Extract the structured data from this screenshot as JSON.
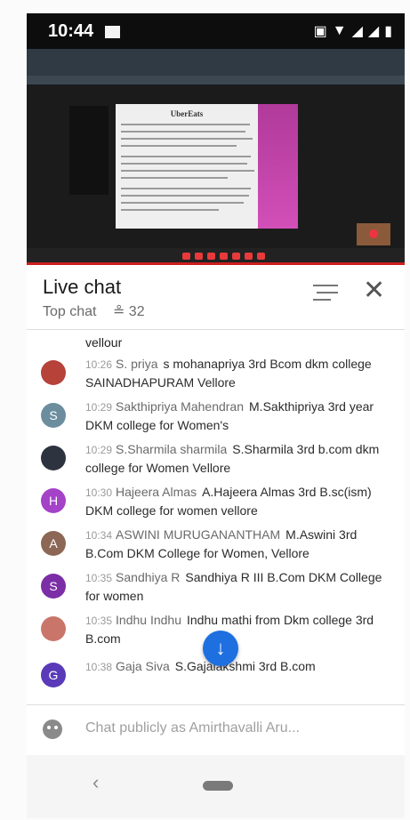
{
  "status_bar": {
    "time": "10:44"
  },
  "video": {
    "slide_title": "UberEats"
  },
  "chat_header": {
    "title": "Live chat",
    "mode": "Top chat",
    "viewer_count": "32"
  },
  "chat": {
    "top_fragment": "vellour",
    "messages": [
      {
        "time": "10:26",
        "author": "S. priya",
        "text": "s mohanapriya 3rd Bcom dkm college SAINADHAPURAM Vellore",
        "avatar_letter": "",
        "avatar_color": "#b6423a"
      },
      {
        "time": "10:29",
        "author": "Sakthipriya Mahendran",
        "text": "M.Sakthipriya 3rd year DKM college for Women's",
        "avatar_letter": "S",
        "avatar_color": "#6b8d9e"
      },
      {
        "time": "10:29",
        "author": "S.Sharmila sharmila",
        "text": "S.Sharmila 3rd b.com dkm college for Women Vellore",
        "avatar_letter": "",
        "avatar_color": "#2e3340"
      },
      {
        "time": "10:30",
        "author": "Hajeera Almas",
        "text": "A.Hajeera Almas 3rd B.sc(ism) DKM college for women vellore",
        "avatar_letter": "H",
        "avatar_color": "#a442c8"
      },
      {
        "time": "10:34",
        "author": "ASWINI MURUGANANTHAM",
        "text": "M.Aswini 3rd B.Com DKM College for Women, Vellore",
        "avatar_letter": "A",
        "avatar_color": "#8c6756"
      },
      {
        "time": "10:35",
        "author": "Sandhiya R",
        "text": "Sandhiya R III B.Com DKM College for women",
        "avatar_letter": "S",
        "avatar_color": "#7b2ea6"
      },
      {
        "time": "10:35",
        "author": "Indhu Indhu",
        "text": "Indhu mathi from Dkm college 3rd B.com",
        "avatar_letter": "",
        "avatar_color": "#c9756a"
      },
      {
        "time": "10:38",
        "author": "Gaja Siva",
        "text": "S.Gajalakshmi 3rd B.com",
        "avatar_letter": "G",
        "avatar_color": "#5a3ab8"
      }
    ]
  },
  "input": {
    "placeholder": "Chat publicly as Amirthavalli Aru..."
  },
  "nav": {
    "back_glyph": "‹"
  },
  "colors": {
    "accent": "#1e6fe0",
    "progress": "#cc1f1f"
  }
}
